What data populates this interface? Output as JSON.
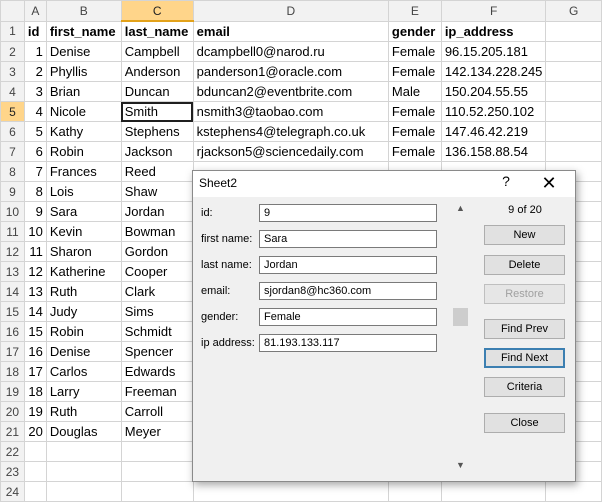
{
  "columns": [
    "A",
    "B",
    "C",
    "D",
    "E",
    "F",
    "G"
  ],
  "selected_column": "C",
  "selected_row": 5,
  "header_row": [
    "id",
    "first_name",
    "last_name",
    "email",
    "gender",
    "ip_address",
    ""
  ],
  "rows": [
    [
      "1",
      "Denise",
      "Campbell",
      "dcampbell0@narod.ru",
      "Female",
      "96.15.205.181",
      ""
    ],
    [
      "2",
      "Phyllis",
      "Anderson",
      "panderson1@oracle.com",
      "Female",
      "142.134.228.245",
      ""
    ],
    [
      "3",
      "Brian",
      "Duncan",
      "bduncan2@eventbrite.com",
      "Male",
      "150.204.55.55",
      ""
    ],
    [
      "4",
      "Nicole",
      "Smith",
      "nsmith3@taobao.com",
      "Female",
      "110.52.250.102",
      ""
    ],
    [
      "5",
      "Kathy",
      "Stephens",
      "kstephens4@telegraph.co.uk",
      "Female",
      "147.46.42.219",
      ""
    ],
    [
      "6",
      "Robin",
      "Jackson",
      "rjackson5@sciencedaily.com",
      "Female",
      "136.158.88.54",
      ""
    ],
    [
      "7",
      "Frances",
      "Reed",
      "",
      "",
      "",
      ""
    ],
    [
      "8",
      "Lois",
      "Shaw",
      "",
      "",
      "",
      ""
    ],
    [
      "9",
      "Sara",
      "Jordan",
      "",
      "",
      "",
      ""
    ],
    [
      "10",
      "Kevin",
      "Bowman",
      "",
      "",
      "",
      ""
    ],
    [
      "11",
      "Sharon",
      "Gordon",
      "",
      "",
      "",
      ""
    ],
    [
      "12",
      "Katherine",
      "Cooper",
      "",
      "",
      "",
      ""
    ],
    [
      "13",
      "Ruth",
      "Clark",
      "",
      "",
      "",
      ""
    ],
    [
      "14",
      "Judy",
      "Sims",
      "",
      "",
      "",
      ""
    ],
    [
      "15",
      "Robin",
      "Schmidt",
      "",
      "",
      "",
      ""
    ],
    [
      "16",
      "Denise",
      "Spencer",
      "",
      "",
      "",
      ""
    ],
    [
      "17",
      "Carlos",
      "Edwards",
      "",
      "",
      "",
      ""
    ],
    [
      "18",
      "Larry",
      "Freeman",
      "",
      "",
      "",
      ""
    ],
    [
      "19",
      "Ruth",
      "Carroll",
      "",
      "",
      "",
      ""
    ],
    [
      "20",
      "Douglas",
      "Meyer",
      "",
      "",
      "",
      ""
    ],
    [
      "",
      "",
      "",
      "",
      "",
      "",
      ""
    ],
    [
      "",
      "",
      "",
      "",
      "",
      "",
      ""
    ],
    [
      "",
      "",
      "",
      "",
      "",
      "",
      ""
    ]
  ],
  "dialog": {
    "title": "Sheet2",
    "help": "?",
    "close": "✕",
    "counter": "9 of 20",
    "fields": [
      {
        "label": "id:",
        "value": "9"
      },
      {
        "label": "first name:",
        "value": "Sara"
      },
      {
        "label": "last name:",
        "value": "Jordan"
      },
      {
        "label": "email:",
        "value": "sjordan8@hc360.com"
      },
      {
        "label": "gender:",
        "value": "Female"
      },
      {
        "label": "ip address:",
        "value": "81.193.133.117"
      }
    ],
    "buttons": {
      "new": "New",
      "delete": "Delete",
      "restore": "Restore",
      "find_prev": "Find Prev",
      "find_next": "Find Next",
      "criteria": "Criteria",
      "close": "Close"
    },
    "scroll_up": "▲",
    "scroll_down": "▼"
  }
}
